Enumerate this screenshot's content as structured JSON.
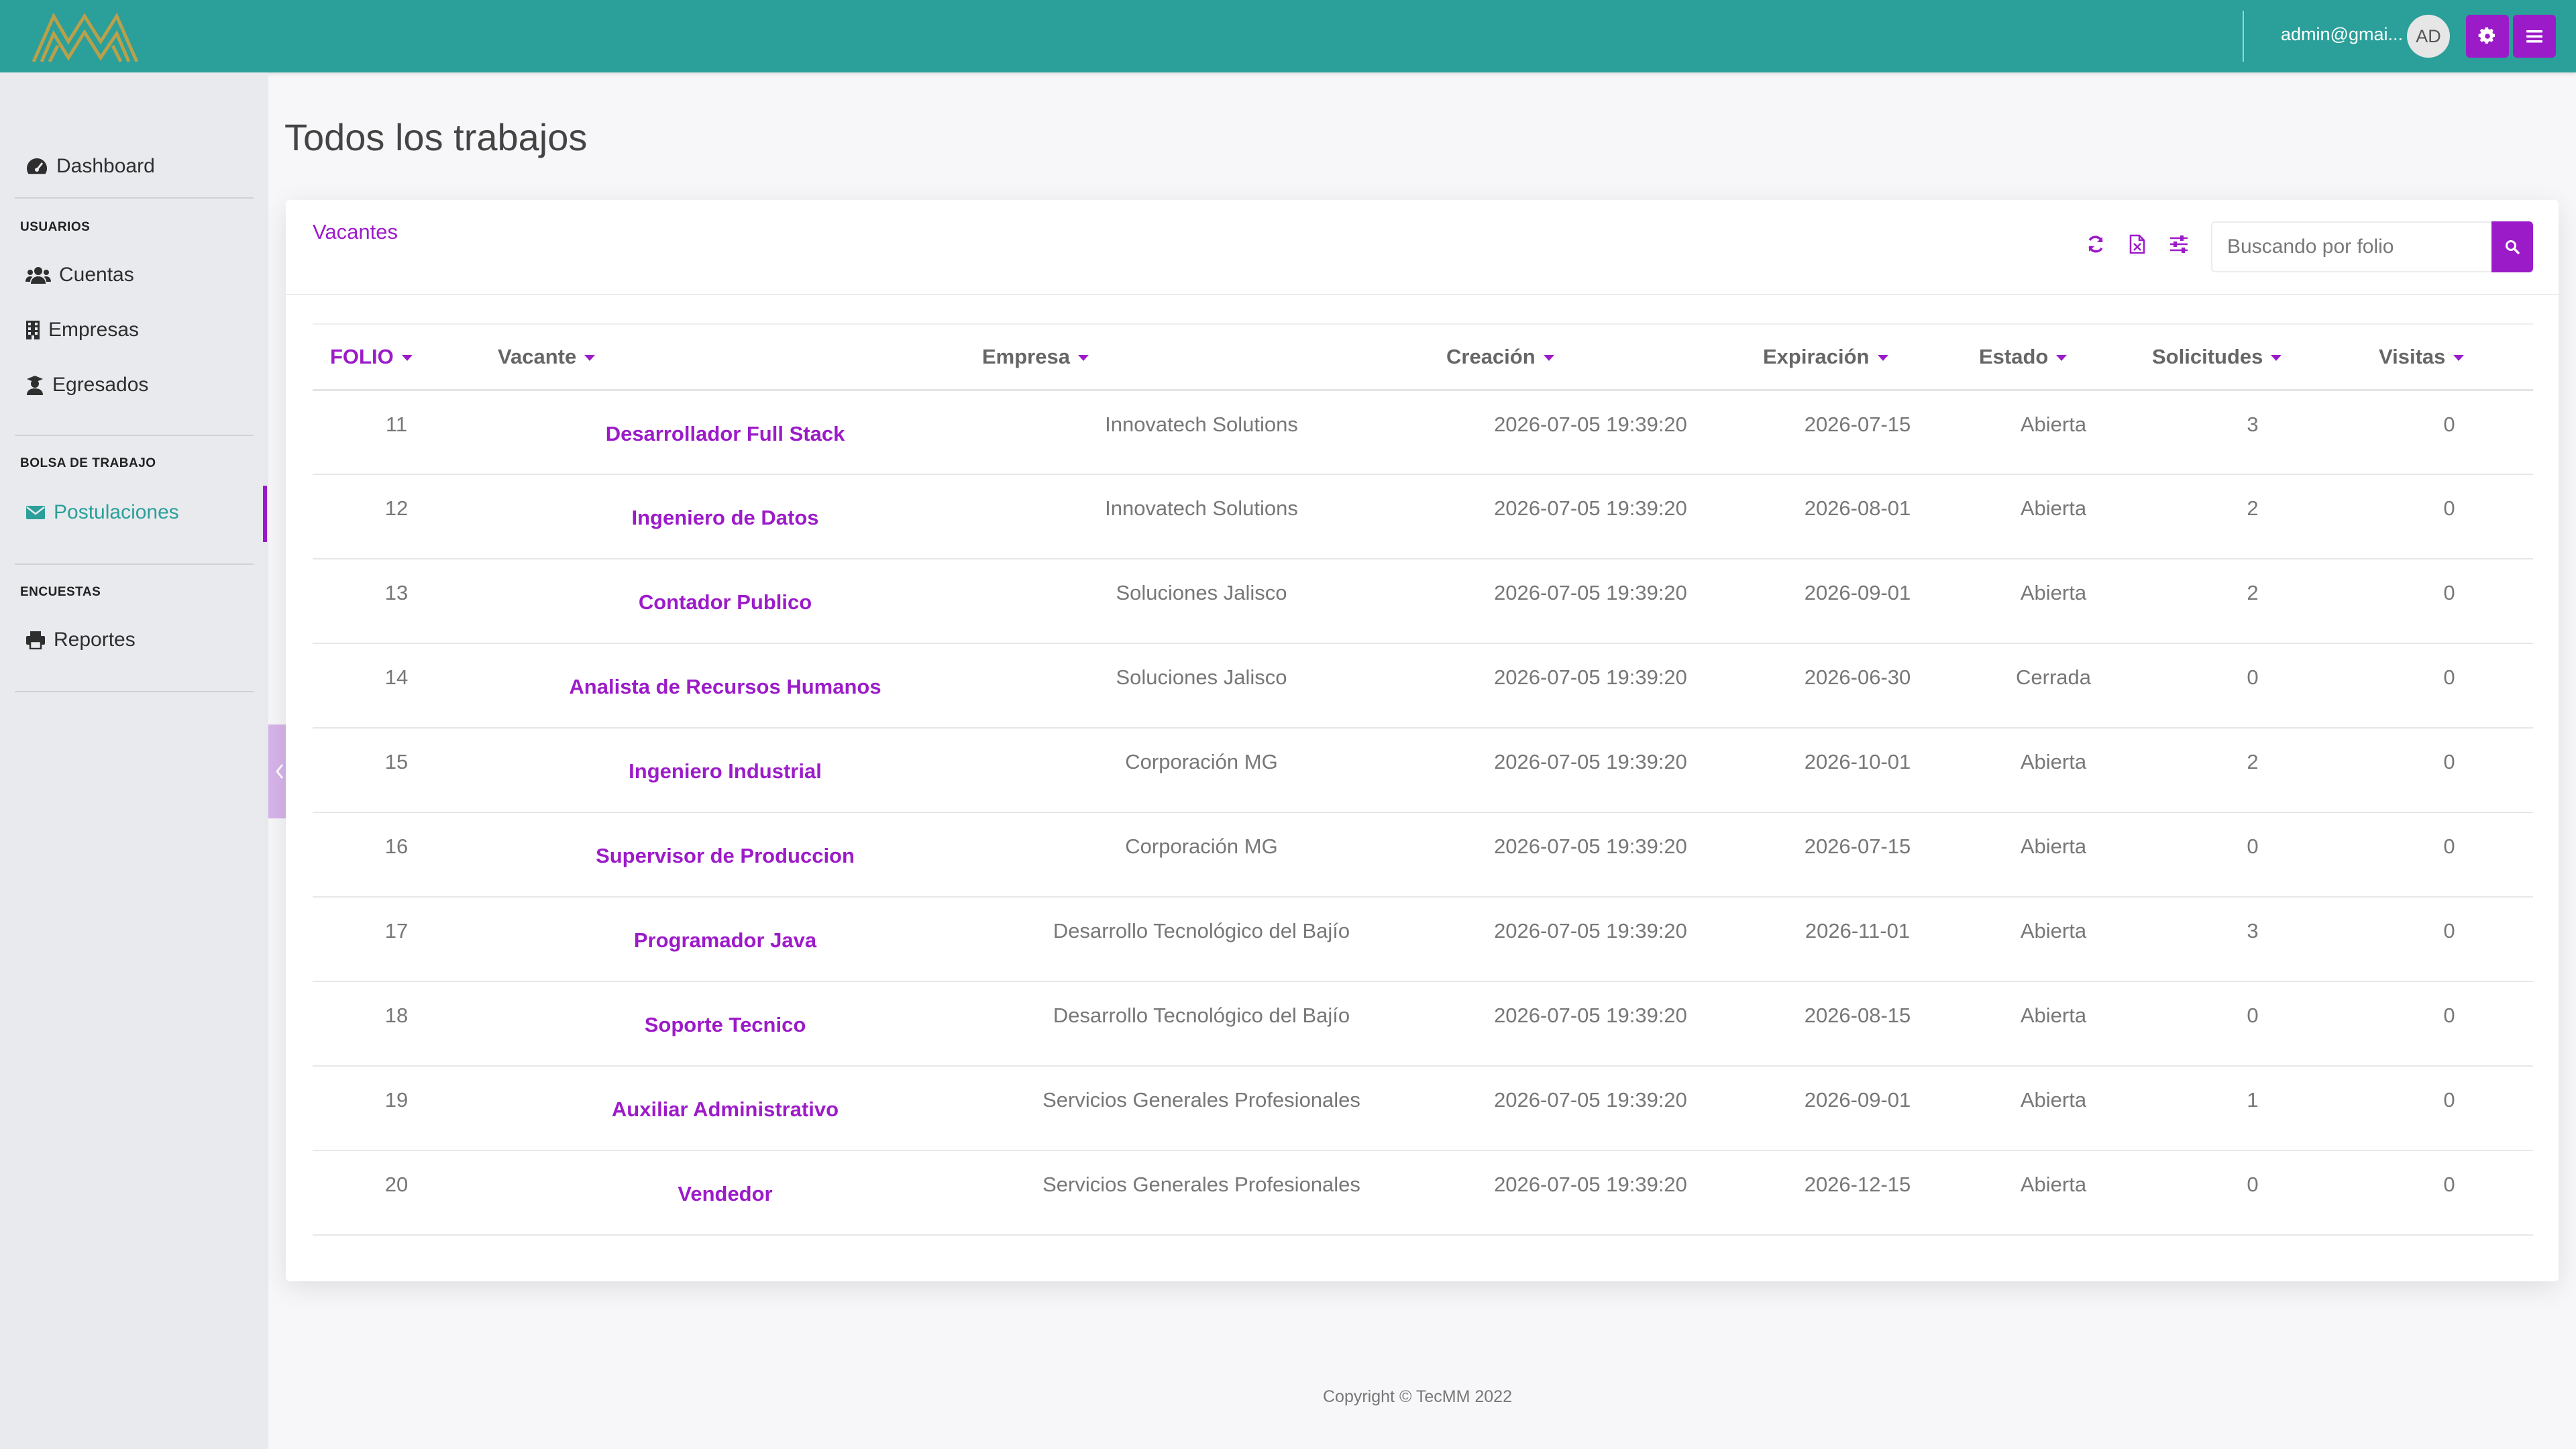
{
  "header": {
    "user_name": "admin@gmai...",
    "avatar_initials": "AD",
    "accent_color": "#9c1bc9",
    "bar_color": "#2b9f9a"
  },
  "sidebar": {
    "dashboard": "Dashboard",
    "sections": {
      "usuarios": "USUARIOS",
      "bolsa": "BOLSA DE TRABAJO",
      "encuestas": "ENCUESTAS"
    },
    "items": {
      "cuentas": "Cuentas",
      "empresas": "Empresas",
      "egresados": "Egresados",
      "postulaciones": "Postulaciones",
      "reportes": "Reportes"
    },
    "active_item": "Postulaciones"
  },
  "page": {
    "title": "Todos los trabajos"
  },
  "card": {
    "title": "Vacantes",
    "search_placeholder": "Buscando por folio"
  },
  "table": {
    "headers": [
      "FOLIO",
      "Vacante",
      "Empresa",
      "Creación",
      "Expiración",
      "Estado",
      "Solicitudes",
      "Visitas"
    ],
    "rows": [
      {
        "folio": "11",
        "vacante": "Desarrollador Full Stack",
        "empresa": "Innovatech Solutions",
        "creacion": "2026-07-05 19:39:20",
        "expiracion": "2026-07-15",
        "estado": "Abierta",
        "solicitudes": "3",
        "visitas": "0"
      },
      {
        "folio": "12",
        "vacante": "Ingeniero de Datos",
        "empresa": "Innovatech Solutions",
        "creacion": "2026-07-05 19:39:20",
        "expiracion": "2026-08-01",
        "estado": "Abierta",
        "solicitudes": "2",
        "visitas": "0"
      },
      {
        "folio": "13",
        "vacante": "Contador Publico",
        "empresa": "Soluciones Jalisco",
        "creacion": "2026-07-05 19:39:20",
        "expiracion": "2026-09-01",
        "estado": "Abierta",
        "solicitudes": "2",
        "visitas": "0"
      },
      {
        "folio": "14",
        "vacante": "Analista de Recursos Humanos",
        "empresa": "Soluciones Jalisco",
        "creacion": "2026-07-05 19:39:20",
        "expiracion": "2026-06-30",
        "estado": "Cerrada",
        "solicitudes": "0",
        "visitas": "0"
      },
      {
        "folio": "15",
        "vacante": "Ingeniero Industrial",
        "empresa": "Corporación MG",
        "creacion": "2026-07-05 19:39:20",
        "expiracion": "2026-10-01",
        "estado": "Abierta",
        "solicitudes": "2",
        "visitas": "0"
      },
      {
        "folio": "16",
        "vacante": "Supervisor de Produccion",
        "empresa": "Corporación MG",
        "creacion": "2026-07-05 19:39:20",
        "expiracion": "2026-07-15",
        "estado": "Abierta",
        "solicitudes": "0",
        "visitas": "0"
      },
      {
        "folio": "17",
        "vacante": "Programador Java",
        "empresa": "Desarrollo Tecnológico del Bajío",
        "creacion": "2026-07-05 19:39:20",
        "expiracion": "2026-11-01",
        "estado": "Abierta",
        "solicitudes": "3",
        "visitas": "0"
      },
      {
        "folio": "18",
        "vacante": "Soporte Tecnico",
        "empresa": "Desarrollo Tecnológico del Bajío",
        "creacion": "2026-07-05 19:39:20",
        "expiracion": "2026-08-15",
        "estado": "Abierta",
        "solicitudes": "0",
        "visitas": "0"
      },
      {
        "folio": "19",
        "vacante": "Auxiliar Administrativo",
        "empresa": "Servicios Generales Profesionales",
        "creacion": "2026-07-05 19:39:20",
        "expiracion": "2026-09-01",
        "estado": "Abierta",
        "solicitudes": "1",
        "visitas": "0"
      },
      {
        "folio": "20",
        "vacante": "Vendedor",
        "empresa": "Servicios Generales Profesionales",
        "creacion": "2026-07-05 19:39:20",
        "expiracion": "2026-12-15",
        "estado": "Abierta",
        "solicitudes": "0",
        "visitas": "0"
      }
    ]
  },
  "footer": {
    "copyright": "Copyright © TecMM 2022"
  },
  "icons": [
    "logo-icon",
    "gear-icon",
    "hamburger-icon",
    "dashboard-gauge-icon",
    "users-icon",
    "building-icon",
    "graduate-icon",
    "envelope-icon",
    "printer-icon",
    "chevron-left-icon",
    "refresh-icon",
    "export-file-icon",
    "filter-sliders-icon",
    "search-icon"
  ]
}
